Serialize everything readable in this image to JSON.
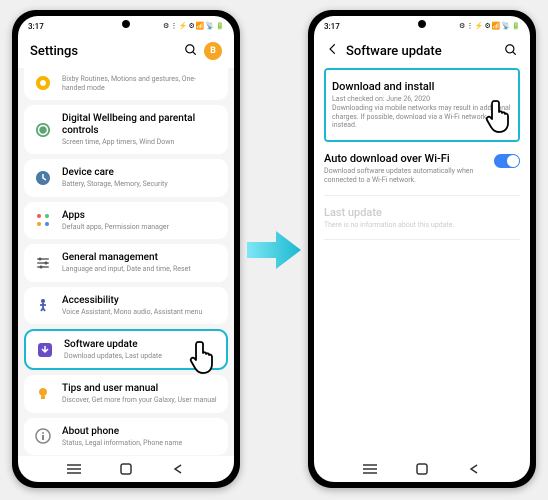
{
  "status": {
    "time": "3:17",
    "icons": "⚙ ⋮ ⚡ ⚙ 📶 📡 🔋"
  },
  "avatar_letter": "B",
  "colors": {
    "highlight": "#1cb8d1",
    "avatar": "#f5a623",
    "toggle_on": "#3a82f7"
  },
  "left_screen": {
    "title": "Settings",
    "items": [
      {
        "icon": "bixby",
        "title": "",
        "sub": "Bixby Routines, Motions and gestures, One-handed mode",
        "first": true
      },
      {
        "icon": "wellbeing",
        "title": "Digital Wellbeing and parental controls",
        "sub": "Screen time, App timers, Wind Down"
      },
      {
        "icon": "device",
        "title": "Device care",
        "sub": "Battery, Storage, Memory, Security"
      },
      {
        "icon": "apps",
        "title": "Apps",
        "sub": "Default apps, Permission manager"
      },
      {
        "icon": "general",
        "title": "General management",
        "sub": "Language and input, Date and time, Reset"
      },
      {
        "icon": "access",
        "title": "Accessibility",
        "sub": "Voice Assistant, Mono audio, Assistant menu"
      },
      {
        "icon": "update",
        "title": "Software update",
        "sub": "Download updates, Last update",
        "highlighted": true,
        "hand": true
      },
      {
        "icon": "tips",
        "title": "Tips and user manual",
        "sub": "Discover, Get more from your Galaxy, User manual"
      },
      {
        "icon": "about",
        "title": "About phone",
        "sub": "Status, Legal information, Phone name"
      }
    ]
  },
  "right_screen": {
    "title": "Software update",
    "items": [
      {
        "title": "Download and install",
        "sub": "Last checked on: June 26, 2020\nDownloading via mobile networks may result in additional charges. If possible, download via a Wi-Fi network instead.",
        "highlighted": true,
        "hand": true
      },
      {
        "title": "Auto download over Wi-Fi",
        "sub": "Download software updates automatically when connected to a Wi-Fi network.",
        "toggle": true,
        "toggle_on": true
      },
      {
        "title": "Last update",
        "sub": "There is no information about this update.",
        "disabled": true
      }
    ]
  }
}
